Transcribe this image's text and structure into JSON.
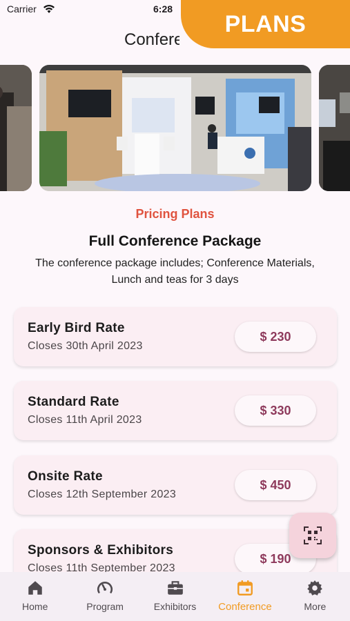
{
  "status_bar": {
    "carrier": "Carrier",
    "time": "6:28"
  },
  "ribbon": {
    "label": "PLANS"
  },
  "header": {
    "title": "Conference"
  },
  "pricing": {
    "section_label": "Pricing Plans",
    "package_title": "Full Conference Package",
    "package_desc_line1": "The conference package includes; Conference Materials,",
    "package_desc_line2": "Lunch and teas for 3 days"
  },
  "plans": [
    {
      "name": "Early Bird Rate",
      "closes": "Closes 30th April 2023",
      "price": "$ 230"
    },
    {
      "name": "Standard Rate",
      "closes": "Closes 11th April 2023",
      "price": "$ 330"
    },
    {
      "name": "Onsite Rate",
      "closes": "Closes 12th September 2023",
      "price": "$ 450"
    },
    {
      "name": "Sponsors & Exhibitors",
      "closes": "Closes 11th September 2023",
      "price": "$ 190"
    }
  ],
  "nav": {
    "items": [
      {
        "label": "Home",
        "icon": "home-icon"
      },
      {
        "label": "Program",
        "icon": "gauge-icon"
      },
      {
        "label": "Exhibitors",
        "icon": "briefcase-icon"
      },
      {
        "label": "Conference",
        "icon": "calendar-icon",
        "active": true
      },
      {
        "label": "More",
        "icon": "gear-icon"
      }
    ]
  },
  "colors": {
    "accent": "#f19b23",
    "price": "#8e3a5c",
    "section_label": "#e0533f",
    "card": "#fbeef3"
  }
}
